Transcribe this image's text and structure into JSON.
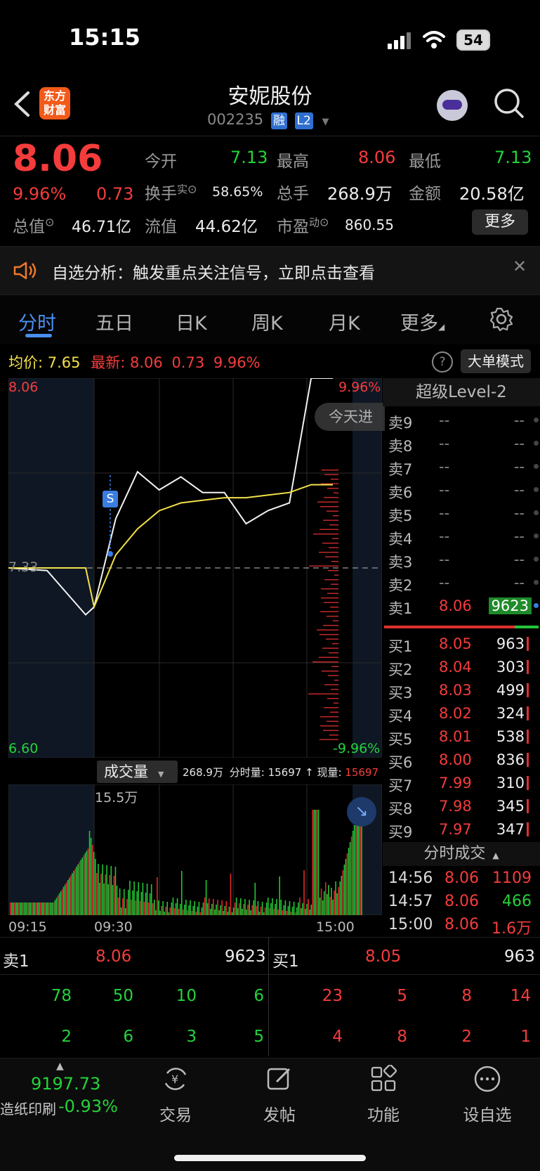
{
  "status_bar": {
    "time": "15:15",
    "battery": "54"
  },
  "nav": {
    "title": "安妮股份",
    "code": "002235",
    "tag1": "融",
    "tag2": "L2",
    "logo_line1": "东方",
    "logo_line2": "财富"
  },
  "quote": {
    "price": "8.06",
    "change_pct": "9.96%",
    "change": "0.73",
    "open_label": "今开",
    "open": "7.13",
    "high_label": "最高",
    "high": "8.06",
    "low_label": "最低",
    "low": "7.13",
    "turnover_label": "换手",
    "turnover_sup": "实",
    "turnover": "58.65%",
    "volume_label": "总手",
    "volume": "268.9万",
    "amount_label": "金额",
    "amount": "20.58亿",
    "mktcap_label": "总值",
    "mktcap": "46.71亿",
    "float_label": "流值",
    "float": "44.62亿",
    "pe_label": "市盈",
    "pe_sup": "动",
    "pe": "860.55",
    "more_label": "更多"
  },
  "notice": {
    "text": "自选分析：触发重点关注信号，立即点击查看"
  },
  "tabs": [
    "分时",
    "五日",
    "日K",
    "周K",
    "月K",
    "更多"
  ],
  "infobar": {
    "avg_label": "均价:",
    "avg": "7.65",
    "last_label": "最新:",
    "last": "8.06",
    "chg": "0.73",
    "pct": "9.96%",
    "mode_btn": "大单模式"
  },
  "chart": {
    "y_top": "8.06",
    "y_mid": "7.33",
    "y_bottom": "6.60",
    "pct_top": "9.96%",
    "pct_bottom": "-9.96%",
    "today_tag": "今天进",
    "s_marker": "S",
    "vol_label": "成交量",
    "vol_total": "268.9万",
    "vol_min_label": "分时量:",
    "vol_min": "15697",
    "vol_now_label": "现量:",
    "vol_now": "15697",
    "vol_max": "15.5万",
    "x_labels": [
      "09:15",
      "09:30",
      "15:00"
    ]
  },
  "chart_data": {
    "type": "line",
    "x": [
      "09:15",
      "09:20",
      "09:25",
      "09:30",
      "09:40",
      "10:00",
      "10:30",
      "11:00",
      "11:30",
      "13:30",
      "14:00",
      "14:30",
      "14:50",
      "14:57",
      "15:00"
    ],
    "series": [
      {
        "values": [
          7.33,
          7.32,
          7.15,
          7.18,
          7.52,
          7.7,
          7.63,
          7.68,
          7.62,
          7.62,
          7.5,
          7.55,
          7.58,
          8.06,
          8.06
        ]
      },
      {
        "values": [
          7.33,
          7.33,
          7.33,
          7.18,
          7.38,
          7.48,
          7.55,
          7.58,
          7.59,
          7.6,
          7.6,
          7.61,
          7.62,
          7.65,
          7.65
        ]
      }
    ],
    "ylim": [
      6.6,
      8.06
    ]
  },
  "level2": {
    "title": "超级Level-2",
    "asks": [
      {
        "label": "卖9",
        "price": "--",
        "vol": "--"
      },
      {
        "label": "卖8",
        "price": "--",
        "vol": "--"
      },
      {
        "label": "卖7",
        "price": "--",
        "vol": "--"
      },
      {
        "label": "卖6",
        "price": "--",
        "vol": "--"
      },
      {
        "label": "卖5",
        "price": "--",
        "vol": "--"
      },
      {
        "label": "卖4",
        "price": "--",
        "vol": "--"
      },
      {
        "label": "卖3",
        "price": "--",
        "vol": "--"
      },
      {
        "label": "卖2",
        "price": "--",
        "vol": "--"
      },
      {
        "label": "卖1",
        "price": "8.06",
        "vol": "9623"
      }
    ],
    "bids": [
      {
        "label": "买1",
        "price": "8.05",
        "vol": "963"
      },
      {
        "label": "买2",
        "price": "8.04",
        "vol": "303"
      },
      {
        "label": "买3",
        "price": "8.03",
        "vol": "499"
      },
      {
        "label": "买4",
        "price": "8.02",
        "vol": "324"
      },
      {
        "label": "买5",
        "price": "8.01",
        "vol": "538"
      },
      {
        "label": "买6",
        "price": "8.00",
        "vol": "836"
      },
      {
        "label": "买7",
        "price": "7.99",
        "vol": "310"
      },
      {
        "label": "买8",
        "price": "7.98",
        "vol": "345"
      },
      {
        "label": "买9",
        "price": "7.97",
        "vol": "347"
      }
    ],
    "ticks_title": "分时成交",
    "ticks": [
      {
        "time": "14:56",
        "price": "8.06",
        "vol": "1109"
      },
      {
        "time": "14:57",
        "price": "8.06",
        "vol": "466"
      },
      {
        "time": "15:00",
        "price": "8.06",
        "vol": "1.6万"
      }
    ]
  },
  "orderbook": {
    "ask_label": "卖1",
    "ask_price": "8.06",
    "ask_vol": "9623",
    "bid_label": "买1",
    "bid_price": "8.05",
    "bid_vol": "963",
    "ask_queue_row1": [
      "78",
      "50",
      "10",
      "6"
    ],
    "ask_queue_row2": [
      "2",
      "6",
      "3",
      "5"
    ],
    "bid_queue_row1": [
      "23",
      "5",
      "8",
      "14"
    ],
    "bid_queue_row2": [
      "4",
      "8",
      "2",
      "1"
    ]
  },
  "tabbar": {
    "index_value": "9197.73",
    "index_name": "造纸印刷",
    "index_pct": "-0.93%",
    "items": [
      "交易",
      "发帖",
      "功能",
      "设自选"
    ]
  }
}
